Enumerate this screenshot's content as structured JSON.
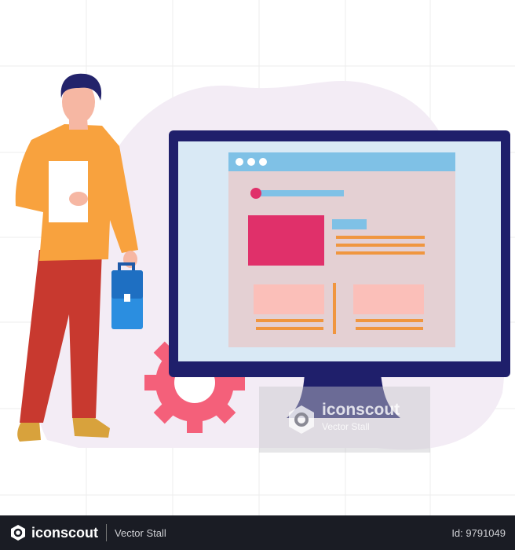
{
  "footer": {
    "brand": "iconscout",
    "author": "Vector Stall",
    "id_label": "Id: 9791049"
  },
  "watermark": {
    "brand": "iconscout",
    "author": "Vector Stall"
  },
  "colors": {
    "monitor_frame": "#1f1f6b",
    "screen": "#d9e9f5",
    "browser_bar": "#7fc1e6",
    "page_bg": "#e4d0d3",
    "hero_block": "#e0306a",
    "cards": "#fbbfb9",
    "lines": "#f0963f",
    "gear": "#f4607a",
    "jacket": "#f8a23e",
    "pants": "#c8392f",
    "bag": "#2b8ee0",
    "background_blob": "#f3ecf5",
    "footer_bg": "#1a1c24"
  }
}
